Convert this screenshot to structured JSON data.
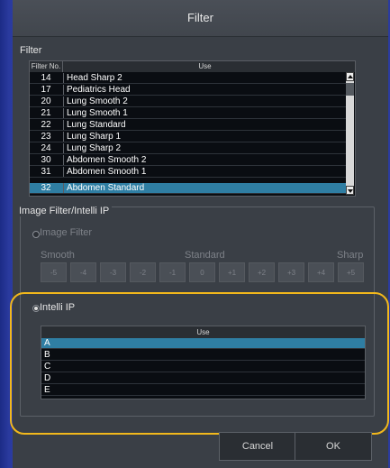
{
  "window": {
    "title": "Filter"
  },
  "filter_group": {
    "label": "Filter",
    "columns": [
      "Filter No.",
      "Use"
    ],
    "rows": [
      {
        "no": "14",
        "use": "Head Sharp 2"
      },
      {
        "no": "17",
        "use": "Pediatrics Head"
      },
      {
        "no": "20",
        "use": "Lung Smooth 2"
      },
      {
        "no": "21",
        "use": "Lung Smooth 1"
      },
      {
        "no": "22",
        "use": "Lung Standard"
      },
      {
        "no": "23",
        "use": "Lung Sharp 1"
      },
      {
        "no": "24",
        "use": "Lung Sharp 2"
      },
      {
        "no": "30",
        "use": "Abdomen Smooth 2"
      },
      {
        "no": "31",
        "use": "Abdomen Smooth 1"
      },
      {
        "no": "32",
        "use": "Abdomen Standard"
      }
    ],
    "selected_index": 9
  },
  "image_filter_group": {
    "label": "Image Filter/Intelli IP",
    "image_filter": {
      "label": "Image Filter",
      "selected": false,
      "scale": {
        "left": "Smooth",
        "center": "Standard",
        "right": "Sharp"
      },
      "levels": [
        "-5",
        "-4",
        "-3",
        "-2",
        "-1",
        "0",
        "+1",
        "+2",
        "+3",
        "+4",
        "+5"
      ]
    },
    "intelli_ip": {
      "label": "Intelli IP",
      "selected": true,
      "column": "Use",
      "rows": [
        "A",
        "B",
        "C",
        "D",
        "E"
      ],
      "selected_index": 0
    }
  },
  "buttons": {
    "cancel": "Cancel",
    "ok": "OK"
  },
  "colors": {
    "selection": "#2f7ea3",
    "highlight_outline": "#f2b81c",
    "background": "#3a3f46"
  }
}
